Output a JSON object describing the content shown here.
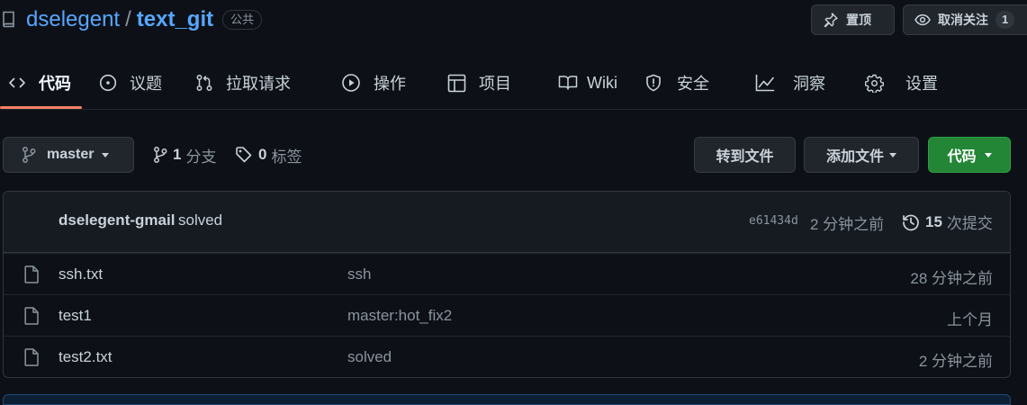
{
  "repo": {
    "owner": "dselegent",
    "separator": "/",
    "name": "text_git",
    "visibility": "公共"
  },
  "header_actions": {
    "pin_label": "置顶",
    "unwatch_label": "取消关注",
    "watch_count": "1"
  },
  "tabs": [
    {
      "label": "代码",
      "icon": "code-icon",
      "active": true
    },
    {
      "label": "议题",
      "icon": "issue-opened-icon"
    },
    {
      "label": "拉取请求",
      "icon": "git-pull-request-icon"
    },
    {
      "label": "操作",
      "icon": "play-icon"
    },
    {
      "label": "项目",
      "icon": "table-icon"
    },
    {
      "label": "Wiki",
      "icon": "book-icon"
    },
    {
      "label": "安全",
      "icon": "shield-icon"
    },
    {
      "label": "洞察",
      "icon": "graph-icon"
    },
    {
      "label": "设置",
      "icon": "gear-icon"
    }
  ],
  "branch_bar": {
    "current_branch": "master",
    "branch_count": "1",
    "branch_label": "分支",
    "tag_count": "0",
    "tag_label": "标签",
    "goto_file_label": "转到文件",
    "add_file_label": "添加文件",
    "code_button_label": "代码"
  },
  "latest_commit": {
    "author": "dselegent-gmail",
    "message": "solved",
    "sha": "e61434d",
    "time": "2 分钟之前",
    "commit_count": "15",
    "commit_label": "次提交"
  },
  "files": [
    {
      "name": "ssh.txt",
      "commit": "ssh",
      "age": "28 分钟之前",
      "icon": "file-icon"
    },
    {
      "name": "test1",
      "commit": "master:hot_fix2",
      "age": "上个月",
      "icon": "file-icon"
    },
    {
      "name": "test2.txt",
      "commit": "solved",
      "age": "2 分钟之前",
      "icon": "file-icon"
    }
  ],
  "colors": {
    "background": "#0d1117",
    "link": "#58a6ff",
    "active_tab_underline": "#f78166",
    "primary_button": "#238636"
  }
}
